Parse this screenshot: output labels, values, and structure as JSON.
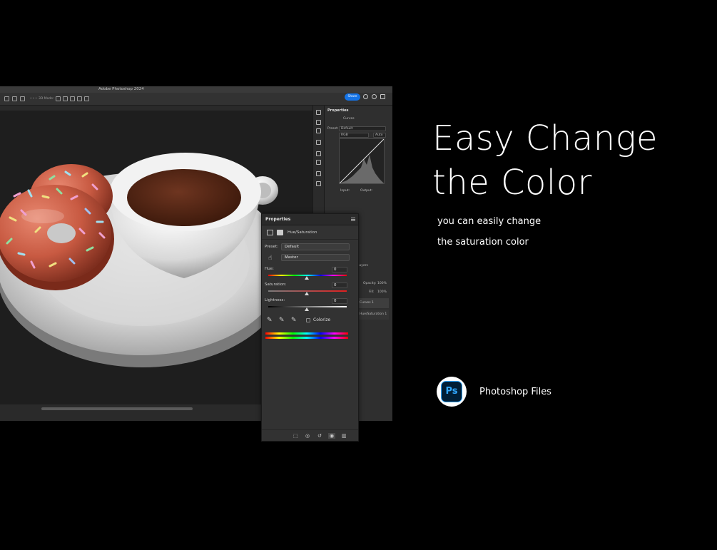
{
  "app": {
    "window_title": "Adobe Photoshop 2024",
    "share_label": "Share",
    "zoom_label": "3D Mode:"
  },
  "right_panel": {
    "title": "Properties",
    "adjustment": "Curves",
    "preset_label": "Preset:",
    "preset_value": "Default",
    "channel": "RGB",
    "auto_label": "Auto",
    "input_label": "Input:",
    "output_label": "Output:",
    "layers_tab": "Layers",
    "opacity_label": "Opacity:",
    "opacity_value": "100%",
    "fill_label": "Fill:",
    "fill_value": "100%",
    "layers": [
      "Curves 1",
      "Hue/Saturation 1"
    ]
  },
  "hs_panel": {
    "tab": "Properties",
    "adjustment": "Hue/Saturation",
    "preset_label": "Preset:",
    "preset_value": "Default",
    "channel_value": "Master",
    "hue_label": "Hue:",
    "hue_value": "0",
    "saturation_label": "Saturation:",
    "saturation_value": "0",
    "lightness_label": "Lightness:",
    "lightness_value": "0",
    "colorize_label": "Colorize"
  },
  "promo": {
    "headline_line1": "Easy Change",
    "headline_line2": "the Color",
    "sub_line1": "you can easily change",
    "sub_line2": "the saturation color",
    "badge_text": "Ps",
    "files_label": "Photoshop Files"
  },
  "colors": {
    "accent_blue": "#1473e6",
    "ps_blue": "#31a8ff",
    "ps_dark": "#001e36",
    "background": "#000000",
    "donut_glaze": "#c85a42",
    "coffee": "#5a2a18"
  }
}
